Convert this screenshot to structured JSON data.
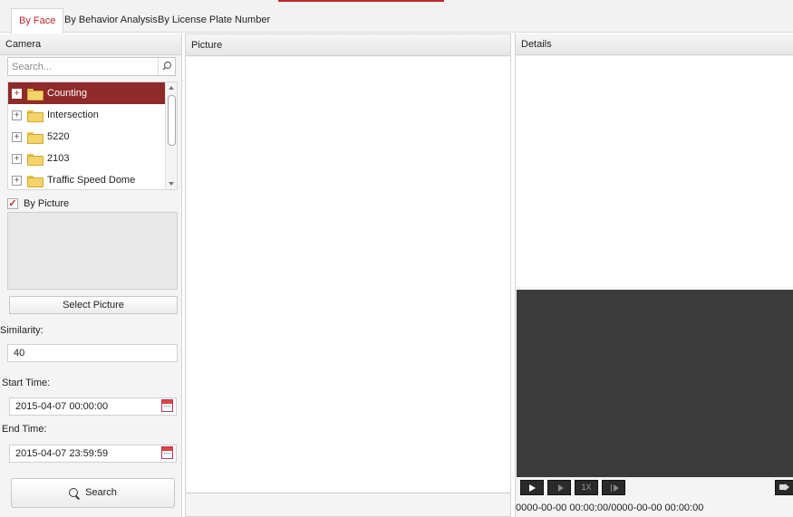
{
  "tabs": [
    {
      "label": "By Face",
      "active": true
    },
    {
      "label": "By Behavior Analysis",
      "active": false
    },
    {
      "label": "By License Plate Number",
      "active": false
    }
  ],
  "left_panel": {
    "title": "Camera",
    "search": {
      "placeholder": "Search...",
      "value": ""
    },
    "tree": [
      {
        "label": "Counting",
        "selected": true
      },
      {
        "label": "Intersection",
        "selected": false
      },
      {
        "label": "5220",
        "selected": false
      },
      {
        "label": "2103",
        "selected": false
      },
      {
        "label": "Traffic Speed Dome",
        "selected": false
      }
    ],
    "by_picture": {
      "label": "By Picture",
      "checked": true
    },
    "select_picture_label": "Select Picture",
    "similarity": {
      "label": "Similarity:",
      "value": "40"
    },
    "start_time": {
      "label": "Start Time:",
      "value": "2015-04-07 00:00:00"
    },
    "end_time": {
      "label": "End Time:",
      "value": "2015-04-07 23:59:59"
    },
    "search_button_label": "Search"
  },
  "middle_panel": {
    "title": "Picture"
  },
  "right_panel": {
    "title": "Details",
    "controls": {
      "speed_label": "1X"
    },
    "time_range": "0000-00-00 00:00:00/0000-00-00 00:00:00"
  },
  "colors": {
    "accent": "#c0262c",
    "selected_row": "#8e2a2a",
    "video_bg": "#3b3b3b"
  }
}
